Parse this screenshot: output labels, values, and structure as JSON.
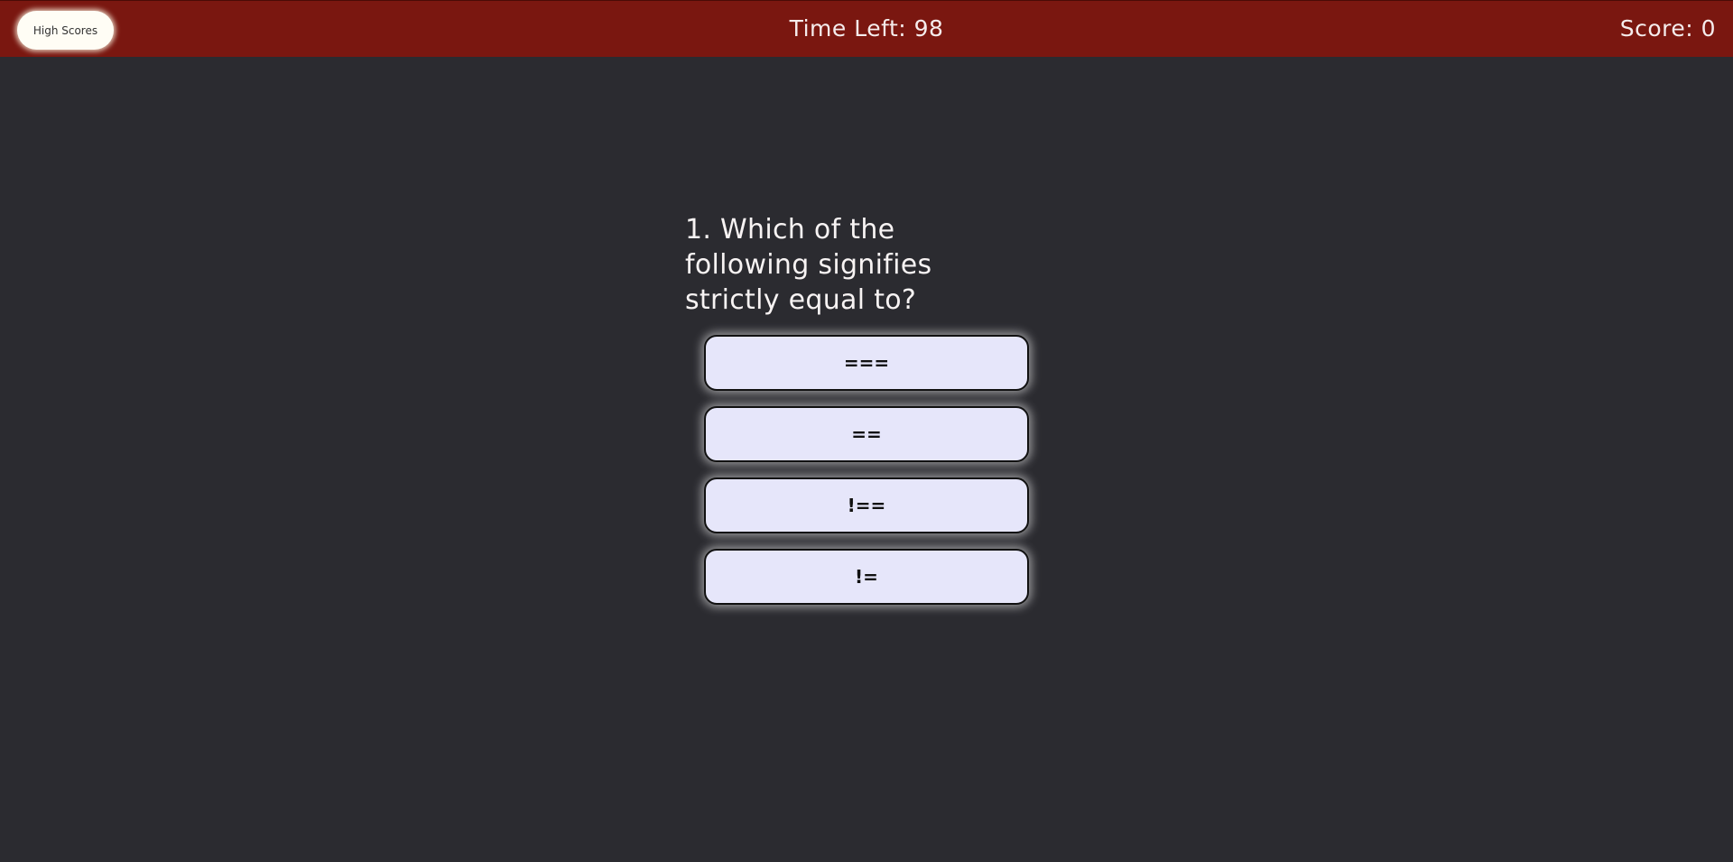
{
  "header": {
    "high_scores_label": "High Scores",
    "timer_text": "Time Left: 98",
    "score_text": "Score: 0"
  },
  "quiz": {
    "question": "1. Which of the following signifies strictly equal to?",
    "answers": [
      "===",
      "==",
      "!==",
      "!="
    ]
  },
  "colors": {
    "header_bg": "#7a1710",
    "page_bg": "#2b2b30",
    "answer_bg": "#e6e6fa"
  }
}
